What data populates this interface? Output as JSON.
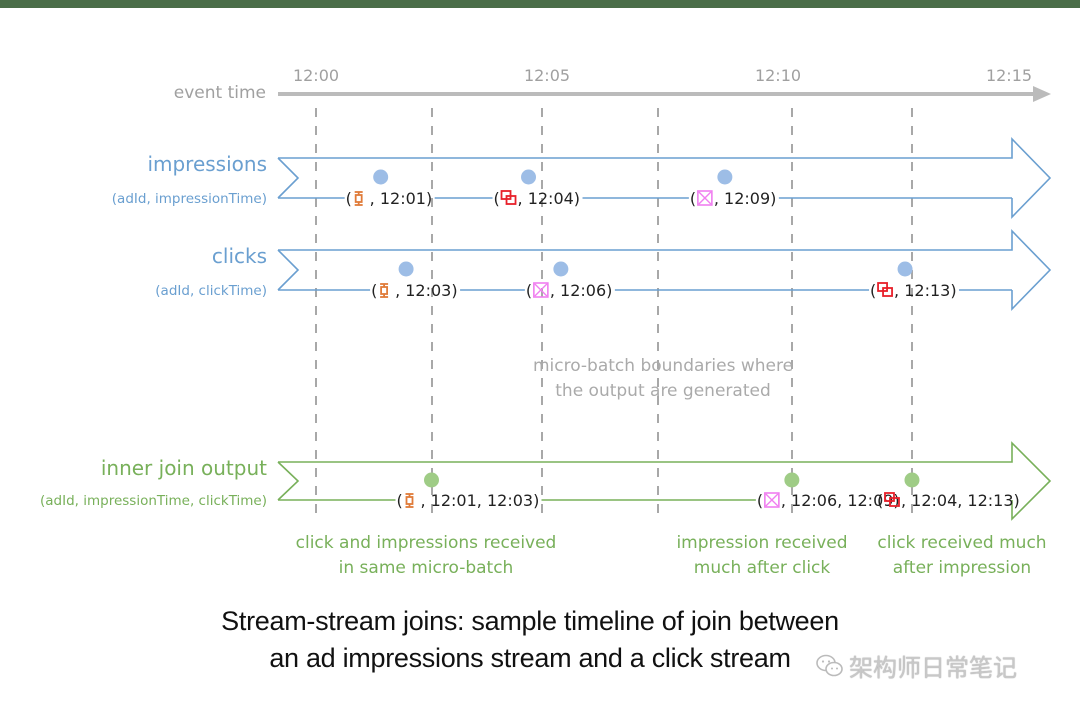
{
  "colors": {
    "topbar": "#4a6d48",
    "axis": "#bbbbbb",
    "axis_text": "#a0a0a0",
    "blue": "#6a9fd0",
    "blue_dot": "#9dbde6",
    "green": "#78b05a",
    "green_dot": "#9fcc86",
    "dash": "#a8a8a8",
    "note_gray": "#aaaaaa",
    "icon_orange": "#e07b39",
    "icon_red": "#e8202a",
    "icon_pink": "#f07ff0",
    "text_dark": "#222222"
  },
  "axis": {
    "label": "event time",
    "ticks": [
      "12:00",
      "12:05",
      "12:10",
      "12:15"
    ],
    "range_minutes": [
      0,
      15
    ]
  },
  "batch_boundaries_minutes": [
    0,
    2.5,
    4.9,
    7.4,
    10.3,
    12.9
  ],
  "streams": [
    {
      "id": "impressions",
      "title": "impressions",
      "schema": "(adId, impressionTime)",
      "color": "blue",
      "events": [
        {
          "ad_icon": "orange-ad-icon",
          "time": "12:01",
          "minute": 1.4
        },
        {
          "ad_icon": "red-ad-icon",
          "time": "12:04",
          "minute": 4.6
        },
        {
          "ad_icon": "pink-ad-icon",
          "time": "12:09",
          "minute": 8.85
        }
      ]
    },
    {
      "id": "clicks",
      "title": "clicks",
      "schema": "(adId, clickTime)",
      "color": "blue",
      "events": [
        {
          "ad_icon": "orange-ad-icon",
          "time": "12:03",
          "minute": 1.95
        },
        {
          "ad_icon": "pink-ad-icon",
          "time": "12:06",
          "minute": 5.3
        },
        {
          "ad_icon": "red-ad-icon",
          "time": "12:13",
          "minute": 12.75
        }
      ]
    },
    {
      "id": "inner-join-output",
      "title": "inner join output",
      "schema": "(adId, impressionTime,  clickTime)",
      "color": "green",
      "events": [
        {
          "ad_icon": "orange-ad-icon",
          "time": "12:01, 12:03",
          "minute": 2.5
        },
        {
          "ad_icon": "pink-ad-icon",
          "time": "12:06, 12:09",
          "minute": 10.3
        },
        {
          "ad_icon": "red-ad-icon",
          "time": "12:04, 12:13",
          "minute": 12.9
        }
      ]
    }
  ],
  "notes": {
    "boundaries": [
      "micro-batch boundaries where",
      "the output are generated"
    ],
    "output_notes": [
      {
        "lines": [
          "click and impressions received",
          "in same micro-batch"
        ]
      },
      {
        "lines": [
          "impression received",
          "much after click"
        ]
      },
      {
        "lines": [
          "click received much",
          "after impression"
        ]
      }
    ]
  },
  "caption": {
    "line1": "Stream-stream joins: sample timeline of join between",
    "line2": "an ad impressions stream and a click stream"
  },
  "watermark": "架构师日常笔记"
}
